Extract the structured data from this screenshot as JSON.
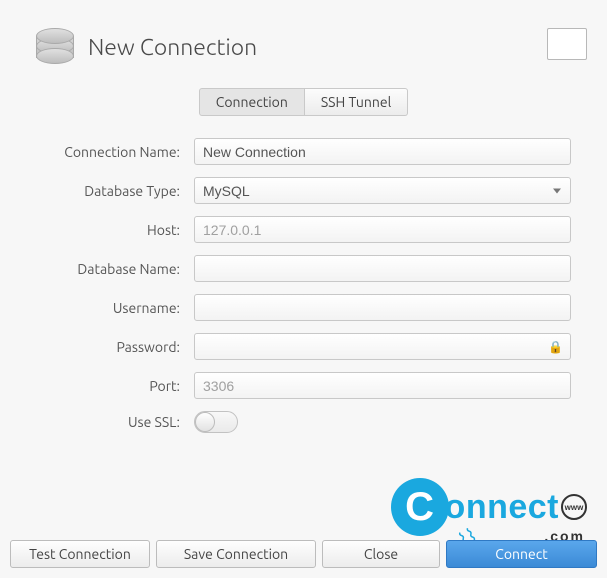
{
  "header": {
    "title": "New Connection"
  },
  "tabs": {
    "connection": "Connection",
    "ssh": "SSH Tunnel",
    "active": "connection"
  },
  "form": {
    "labels": {
      "conn_name": "Connection Name:",
      "db_type": "Database Type:",
      "host": "Host:",
      "db_name": "Database Name:",
      "username": "Username:",
      "password": "Password:",
      "port": "Port:",
      "use_ssl": "Use SSL:"
    },
    "values": {
      "conn_name": "New Connection",
      "db_type": "MySQL",
      "host": "",
      "db_name": "",
      "username": "",
      "password": "",
      "port": "",
      "use_ssl": false
    },
    "placeholders": {
      "host": "127.0.0.1",
      "port": "3306"
    }
  },
  "buttons": {
    "test": "Test Connection",
    "save": "Save Connection",
    "close": "Close",
    "connect": "Connect"
  },
  "watermark": {
    "brand": "onnect",
    "letter": "C",
    "tld": ".com",
    "globe": "www"
  }
}
